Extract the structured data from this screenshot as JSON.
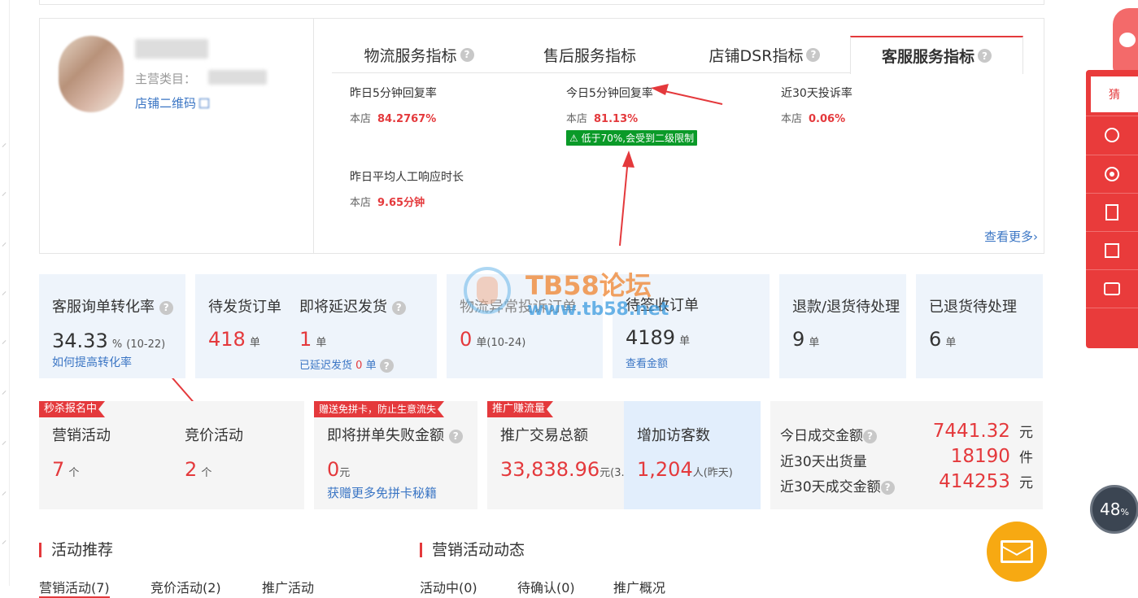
{
  "store": {
    "category_label": "主营类目：",
    "qrcode_label": "店铺二维码"
  },
  "tabs": [
    {
      "label": "物流服务指标"
    },
    {
      "label": "售后服务指标"
    },
    {
      "label": "店铺DSR指标"
    },
    {
      "label": "客服服务指标"
    }
  ],
  "active_tab": "客服服务指标",
  "metrics": [
    {
      "label": "昨日5分钟回复率",
      "prefix": "本店",
      "value": "84.2767%"
    },
    {
      "label": "今日5分钟回复率",
      "prefix": "本店",
      "value": "81.13%",
      "warning": "低于70%,会受到二级限制"
    },
    {
      "label": "近30天投诉率",
      "prefix": "本店",
      "value": "0.06%"
    },
    {
      "label": "昨日平均人工响应时长",
      "prefix": "本店",
      "value": "9.65分钟"
    }
  ],
  "more_link": "查看更多",
  "stats": {
    "conversion": {
      "title": "客服询单转化率",
      "value": "34.33",
      "unit": "%",
      "date": "(10-22)",
      "link": "如何提高转化率"
    },
    "pending_ship": {
      "title": "待发货订单",
      "value": "418",
      "unit": "单"
    },
    "delayed": {
      "title": "即将延迟发货",
      "value": "1",
      "unit": "单",
      "sub_label": "已延迟发货",
      "sub_value": "0",
      "sub_unit": "单"
    },
    "logistics": {
      "title": "物流异常投诉订单",
      "value": "0",
      "unit": "单(10-24)"
    },
    "receiving": {
      "title": "待签收订单",
      "value": "4189",
      "unit": "单",
      "link": "查看金额"
    },
    "refund": {
      "title": "退款/退货待处理",
      "value": "9",
      "unit": "单"
    },
    "returned": {
      "title": "已退货待处理",
      "value": "6",
      "unit": "单"
    }
  },
  "promo": {
    "flash_ribbon": "秒杀报名中",
    "marketing": {
      "title": "营销活动",
      "value": "7",
      "unit": "个"
    },
    "bidding": {
      "title": "竞价活动",
      "value": "2",
      "unit": "个"
    },
    "card_ribbon": "赠送免拼卡，防止生意流失",
    "fail": {
      "title": "即将拼单失败金额",
      "value": "0",
      "unit": "元",
      "link": "获赠更多免拼卡秘籍"
    },
    "traffic_ribbon": "推广赚流量",
    "promo_total": {
      "title": "推广交易总额",
      "value": "33,838.96",
      "unit": "元(3..."
    },
    "visitors": {
      "title": "增加访客数",
      "value": "1,204",
      "unit": "人(昨天)"
    },
    "today": {
      "label": "今日成交金额",
      "value": "7441.32",
      "unit": "元"
    },
    "ship30": {
      "label": "近30天出货量",
      "value": "18190",
      "unit": "件"
    },
    "amount30": {
      "label": "近30天成交金额",
      "value": "414253",
      "unit": "元"
    }
  },
  "sections": {
    "recommend": {
      "title": "活动推荐",
      "tabs": [
        "营销活动(7)",
        "竞价活动(2)",
        "推广活动"
      ]
    },
    "dynamics": {
      "title": "营销活动动态",
      "tabs": [
        "活动中(0)",
        "待确认(0)",
        "推广概况"
      ]
    }
  },
  "watermark": {
    "title": "TB58论坛",
    "url": "www.tb58.net"
  },
  "sidebar": {
    "top_label": "猜"
  },
  "progress": {
    "value": "48",
    "unit": "%"
  },
  "colors": {
    "accent": "#e4393c",
    "link": "#3a75c4",
    "warning": "#0a9a28",
    "card": "#eef4fb"
  }
}
